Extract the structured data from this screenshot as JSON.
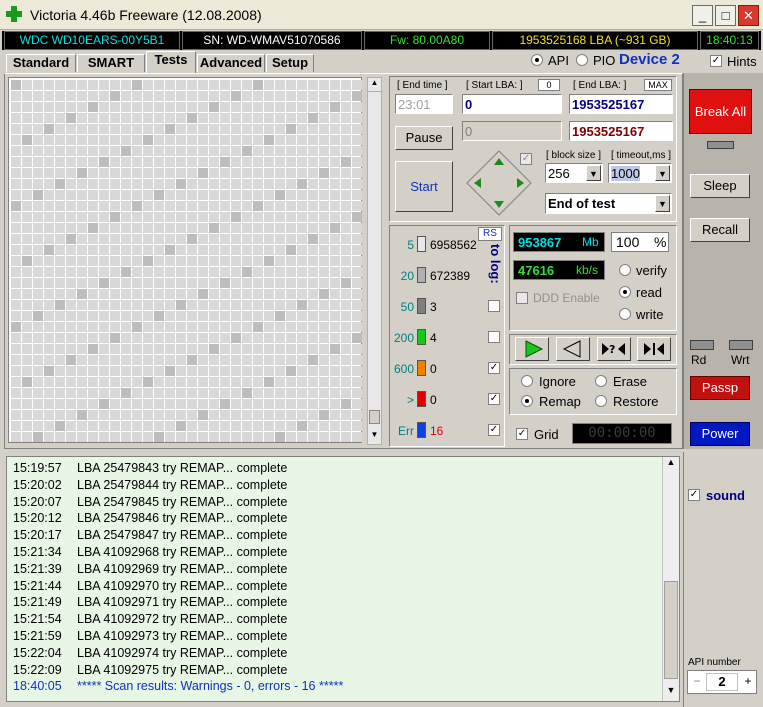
{
  "window": {
    "title": "Victoria 4.46b Freeware (12.08.2008)",
    "min": "_",
    "max": "□",
    "close": "✕"
  },
  "info": {
    "model": "WDC WD10EARS-00Y5B1",
    "serial": "SN: WD-WMAV51070586",
    "firmware": "Fw: 80.00A80",
    "lba": "1953525168 LBA (~931 GB)",
    "clock": "18:40:13"
  },
  "tabs": [
    "Standard",
    "SMART",
    "Tests",
    "Advanced",
    "Setup"
  ],
  "mode": {
    "api": "API",
    "pio": "PIO",
    "device": "Device 2",
    "hints": "Hints"
  },
  "test": {
    "end_time_label": "[ End time ]",
    "end_time": "23:01",
    "start_lba_label": "[ Start LBA: ]",
    "start_lba_badge": "0",
    "start_lba": "0",
    "start_lba2": "0",
    "end_lba_label": "[ End LBA: ]",
    "end_lba_badge": "MAX",
    "end_lba": "1953525167",
    "end_lba2": "1953525167",
    "pause": "Pause",
    "start": "Start",
    "block_size_label": "[ block size ]",
    "block_size": "256",
    "timeout_label": "[ timeout,ms ]",
    "timeout": "1000",
    "end_action": "End of test"
  },
  "stats": {
    "rs": "RS",
    "to_log": "to log:",
    "rows": [
      {
        "ms": "5",
        "count": "6958562",
        "color": "#e8e8e8"
      },
      {
        "ms": "20",
        "count": "672389",
        "color": "#b0b0b0"
      },
      {
        "ms": "50",
        "count": "3",
        "color": "#808080"
      },
      {
        "ms": "200",
        "count": "4",
        "color": "#18c818"
      },
      {
        "ms": "600",
        "count": "0",
        "color": "#f08000"
      },
      {
        "ms": ">",
        "count": "0",
        "color": "#e00000"
      },
      {
        "ms": "Err",
        "count": "16",
        "color": "#1040e0"
      }
    ]
  },
  "speed": {
    "mb": "953867",
    "mb_unit": "Mb",
    "percent": "100",
    "pct_unit": "%",
    "kbs": "47616",
    "kbs_unit": "kb/s",
    "ddd": "DDD Enable",
    "verify": "verify",
    "read": "read",
    "write": "write"
  },
  "actions": {
    "ignore": "Ignore",
    "erase": "Erase",
    "remap": "Remap",
    "restore": "Restore",
    "grid": "Grid",
    "timer": "00:00:00"
  },
  "side": {
    "break_all": "Break All",
    "sleep": "Sleep",
    "recall": "Recall",
    "rd": "Rd",
    "wrt": "Wrt",
    "passp": "Passp",
    "power": "Power",
    "sound": "sound",
    "api_number_label": "API number",
    "api_number": "2",
    "minus": "−",
    "plus": "+"
  },
  "log": [
    {
      "t": "15:19:57",
      "m": "LBA 25479843 try REMAP... complete"
    },
    {
      "t": "15:20:02",
      "m": "LBA 25479844 try REMAP... complete"
    },
    {
      "t": "15:20:07",
      "m": "LBA 25479845 try REMAP... complete"
    },
    {
      "t": "15:20:12",
      "m": "LBA 25479846 try REMAP... complete"
    },
    {
      "t": "15:20:17",
      "m": "LBA 25479847 try REMAP... complete"
    },
    {
      "t": "15:21:34",
      "m": "LBA 41092968 try REMAP... complete"
    },
    {
      "t": "15:21:39",
      "m": "LBA 41092969 try REMAP... complete"
    },
    {
      "t": "15:21:44",
      "m": "LBA 41092970 try REMAP... complete"
    },
    {
      "t": "15:21:49",
      "m": "LBA 41092971 try REMAP... complete"
    },
    {
      "t": "15:21:54",
      "m": "LBA 41092972 try REMAP... complete"
    },
    {
      "t": "15:21:59",
      "m": "LBA 41092973 try REMAP... complete"
    },
    {
      "t": "15:22:04",
      "m": "LBA 41092974 try REMAP... complete"
    },
    {
      "t": "15:22:09",
      "m": "LBA 41092975 try REMAP... complete"
    },
    {
      "t": "18:40:05",
      "m": "***** Scan results: Warnings - 0, errors - 16 *****",
      "summary": true
    }
  ]
}
